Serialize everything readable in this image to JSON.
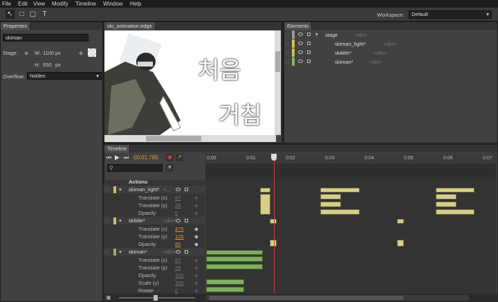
{
  "menu": [
    "File",
    "Edit",
    "View",
    "Modify",
    "Timeline",
    "Window",
    "Help"
  ],
  "toolbar": {
    "workspace_label": "Workspace:",
    "workspace_value": "Default",
    "text_tool": "T"
  },
  "properties": {
    "tab": "Properties",
    "name": "skiman",
    "stage_label": "Stage:",
    "w_label": "W:",
    "w_value": "1100",
    "w_unit": "px",
    "h_label": "H:",
    "h_value": "550",
    "h_unit": "px",
    "overflow_label": "Overflow:",
    "overflow_value": "hidden"
  },
  "stage_tab": "ski_animation.edge",
  "stage_text": [
    "처음",
    "거침"
  ],
  "elements": {
    "tab": "Elements",
    "rows": [
      {
        "name": "stage",
        "tag": "<div>",
        "color": "#9a9a9a"
      },
      {
        "name": "skiman_light*",
        "tag": "<div>",
        "color": "#c8c15a"
      },
      {
        "name": "skititle*",
        "tag": "<div>",
        "color": "#c8c15a"
      },
      {
        "name": "skiman*",
        "tag": "<div>",
        "color": "#7dbd5a"
      }
    ]
  },
  "timeline": {
    "tab": "Timeline",
    "time": "00:01.785",
    "ticks": [
      "0:00",
      "0:01",
      "0:02",
      "0:03",
      "0:04",
      "0:05",
      "0:06",
      "0:07"
    ],
    "rows": [
      {
        "label": "Actions",
        "type": "group"
      },
      {
        "label": "skiman_light*",
        "tag": "<...",
        "type": "el",
        "color": "#c8c15a"
      },
      {
        "label": "Translate (x)",
        "value": "67",
        "type": "prop",
        "active": false
      },
      {
        "label": "Translate (y)",
        "value": "29",
        "type": "prop",
        "active": false
      },
      {
        "label": "Opacity",
        "value": "0",
        "type": "prop",
        "active": false
      },
      {
        "label": "skititle*",
        "tag": "<div>",
        "type": "el",
        "color": "#c8c15a"
      },
      {
        "label": "Translate (x)",
        "value": "475",
        "type": "prop",
        "active": true
      },
      {
        "label": "Translate (y)",
        "value": "125",
        "type": "prop",
        "active": true
      },
      {
        "label": "Opacity",
        "value": "65",
        "type": "prop",
        "active": true
      },
      {
        "label": "skiman*",
        "tag": "<div>",
        "type": "el",
        "color": "#7dbd5a"
      },
      {
        "label": "Translate (x)",
        "value": "67",
        "type": "prop",
        "active": false
      },
      {
        "label": "Translate (y)",
        "value": "29",
        "type": "prop",
        "active": false
      },
      {
        "label": "Opacity",
        "value": "100",
        "type": "prop",
        "active": false
      },
      {
        "label": "Scale (y)",
        "value": "100",
        "type": "prop",
        "active": false
      },
      {
        "label": "Rotate",
        "value": "0",
        "type": "prop",
        "active": false
      }
    ]
  }
}
